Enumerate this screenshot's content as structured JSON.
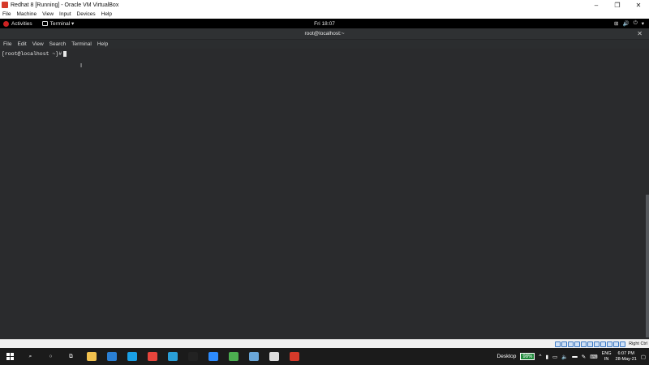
{
  "vbox": {
    "title": "Redhat 8 [Running] - Oracle VM VirtualBox",
    "controls": [
      "–",
      "❐",
      "✕"
    ],
    "menu": [
      "File",
      "Machine",
      "View",
      "Input",
      "Devices",
      "Help"
    ],
    "status_right": "Right Ctrl"
  },
  "gnome": {
    "activities": "Activities",
    "app_menu": "Terminal ▾",
    "clock": "Fri 18:07",
    "tray": [
      "⊞",
      "🔊",
      "⏻",
      "▾"
    ]
  },
  "terminal": {
    "title": "root@localhost:~",
    "close": "✕",
    "menu": [
      "File",
      "Edit",
      "View",
      "Search",
      "Terminal",
      "Help"
    ],
    "prompt": "[root@localhost ~]#",
    "input_value": ""
  },
  "taskbar": {
    "desktop_label": "Desktop",
    "battery": "98%",
    "lang_top": "ENG",
    "lang_bottom": "IN",
    "time": "6:07 PM",
    "date": "28-May-21"
  },
  "icons": {
    "apps": [
      {
        "name": "file-explorer-icon",
        "color": "#f2c14e"
      },
      {
        "name": "mail-icon",
        "color": "#2a7fd4"
      },
      {
        "name": "l-app-icon",
        "color": "#1aa0e6"
      },
      {
        "name": "chrome-icon",
        "color": "#e8453c"
      },
      {
        "name": "edge-icon",
        "color": "#2a9fd8"
      },
      {
        "name": "cmd-icon",
        "color": "#222222"
      },
      {
        "name": "zoom-icon",
        "color": "#2d8cff"
      },
      {
        "name": "green-app-icon",
        "color": "#4caf50"
      },
      {
        "name": "virtualbox-icon",
        "color": "#6aa6d8"
      },
      {
        "name": "photos-icon",
        "color": "#dddddd"
      },
      {
        "name": "redhat-vm-icon",
        "color": "#d63a2a"
      }
    ]
  }
}
